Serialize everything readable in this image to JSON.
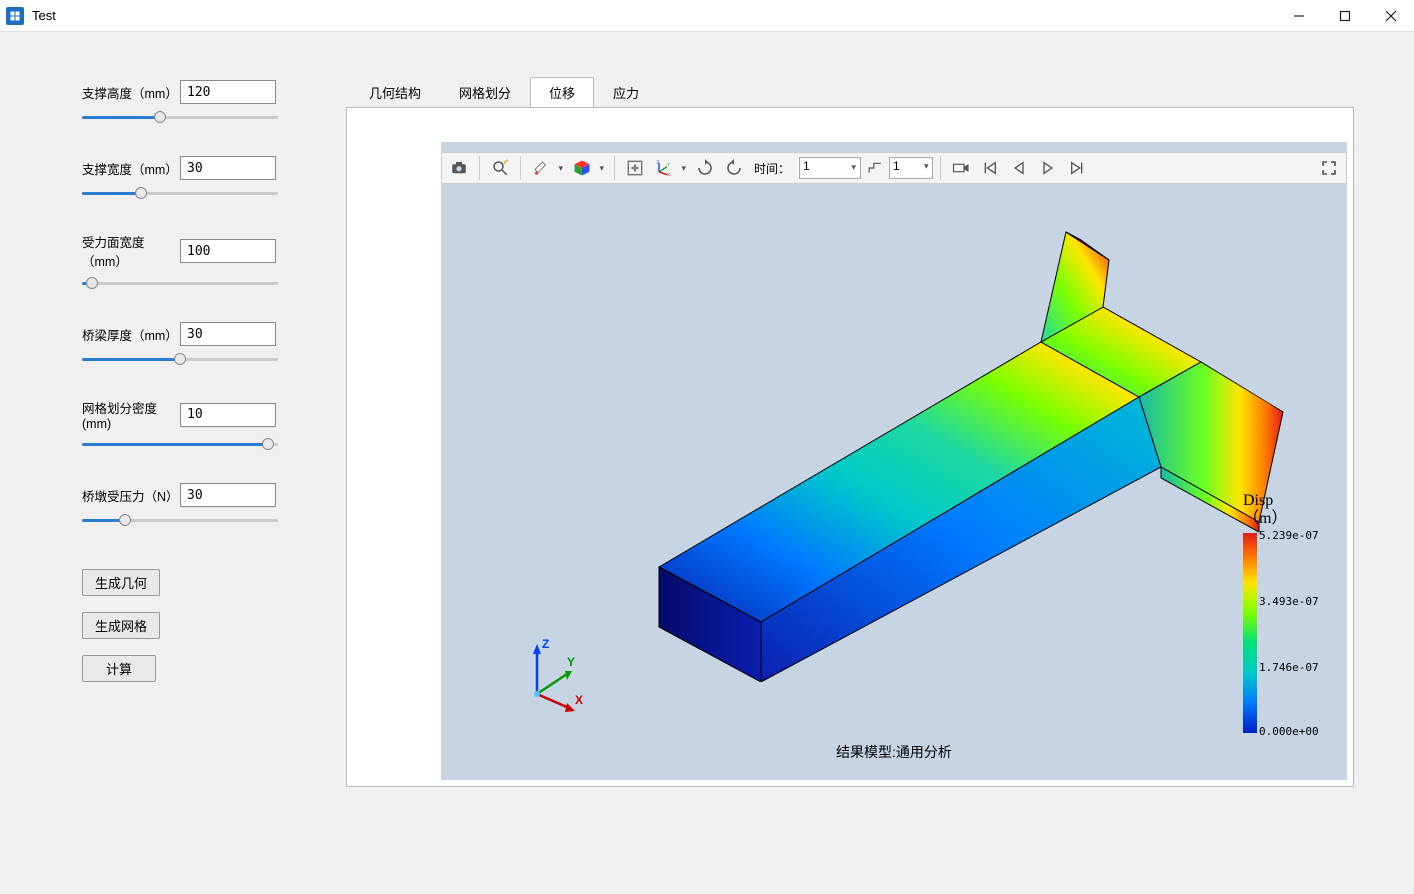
{
  "window": {
    "title": "Test"
  },
  "params": [
    {
      "label": "支撑高度（mm）",
      "value": "120",
      "fill": 40
    },
    {
      "label": "支撑宽度（mm）",
      "value": "30",
      "fill": 30
    },
    {
      "label": "受力面宽度（mm）",
      "value": "100",
      "fill": 5
    },
    {
      "label": "桥梁厚度（mm）",
      "value": "30",
      "fill": 50
    },
    {
      "label": "网格划分密度(mm)",
      "value": "10",
      "fill": 95
    },
    {
      "label": "桥墩受压力（N）",
      "value": "30",
      "fill": 22
    }
  ],
  "buttons": {
    "gen_geom": "生成几何",
    "gen_mesh": "生成网格",
    "compute": "计算"
  },
  "tabs": {
    "geom": "几何结构",
    "mesh": "网格划分",
    "disp": "位移",
    "stress": "应力",
    "active": "disp"
  },
  "toolbar": {
    "time_label": "时间：",
    "time_value": "1",
    "step_value": "1"
  },
  "legend": {
    "title1": "Disp",
    "title2": "（m）",
    "ticks": [
      "5.239e-07",
      "3.493e-07",
      "1.746e-07",
      "0.000e+00"
    ]
  },
  "result_label": "结果模型:通用分析"
}
